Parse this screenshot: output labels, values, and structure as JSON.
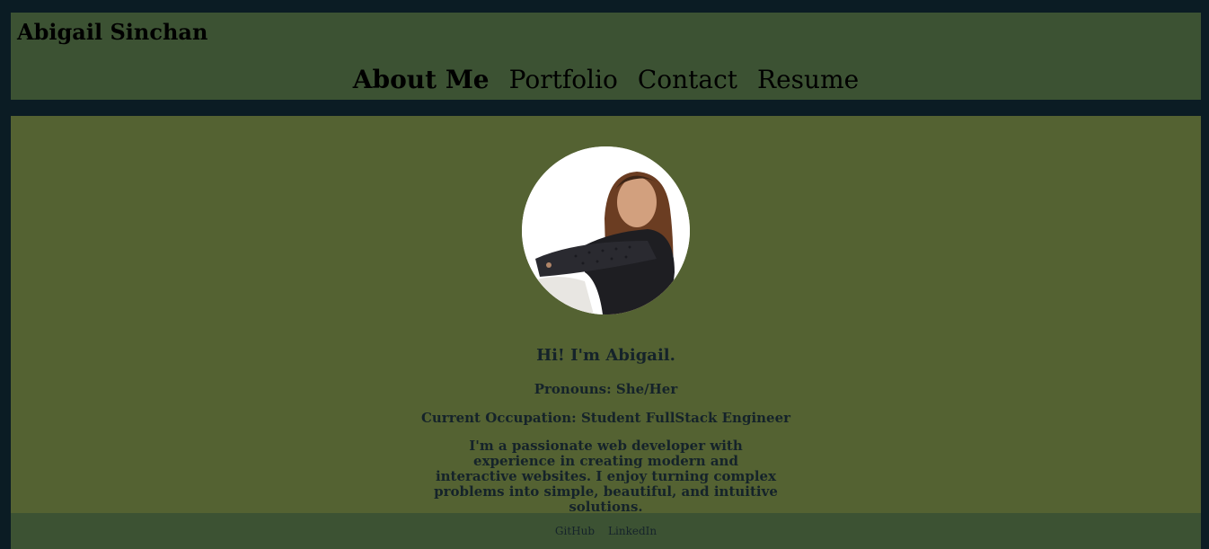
{
  "header": {
    "title": "Abigail Sinchan",
    "nav": [
      {
        "label": "About Me",
        "active": true
      },
      {
        "label": "Portfolio",
        "active": false
      },
      {
        "label": "Contact",
        "active": false
      },
      {
        "label": "Resume",
        "active": false
      }
    ]
  },
  "main": {
    "greeting": "Hi! I'm Abigail.",
    "pronouns": "Pronouns: She/Her",
    "occupation": "Current Occupation: Student FullStack Engineer",
    "bio": "I'm a passionate web developer with experience in creating modern and interactive websites. I enjoy turning complex problems into simple, beautiful, and intuitive solutions."
  },
  "footer": {
    "links": [
      "GitHub",
      "LinkedIn"
    ]
  },
  "colors": {
    "page_background": "#0b1c24",
    "header_background": "#3c5233",
    "main_background": "#546232",
    "text_dark": "#15232a"
  }
}
